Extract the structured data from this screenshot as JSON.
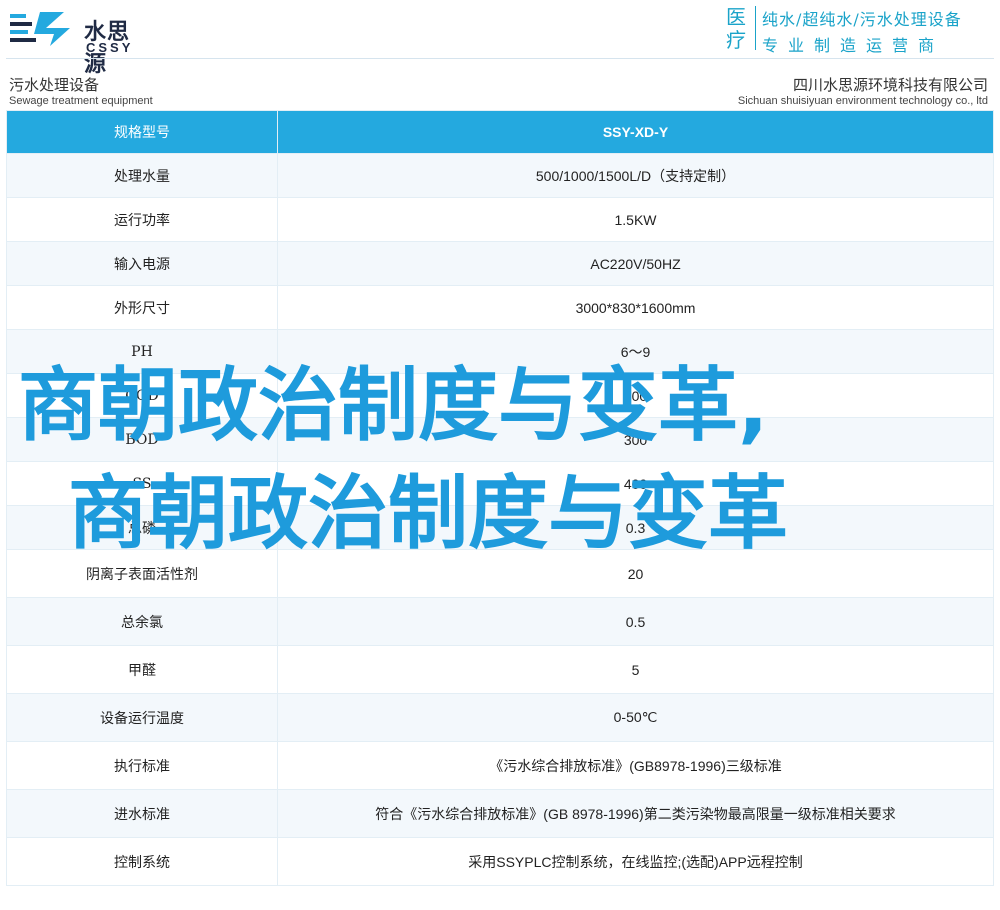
{
  "brand": {
    "name_cn": "水思源",
    "name_en": "CSSY"
  },
  "tagline": {
    "side": [
      "医",
      "疗"
    ],
    "line1": "纯水/超纯水/污水处理设备",
    "line2": "专业制造运营商"
  },
  "subheader": {
    "title_cn": "污水处理设备",
    "title_en": "Sewage treatment equipment",
    "company_cn": "四川水思源环境科技有限公司",
    "company_en": "Sichuan shuisiyuan environment technology co., ltd"
  },
  "spec_table": {
    "header": {
      "label": "规格型号",
      "value": "SSY-XD-Y"
    },
    "rows": [
      {
        "label": "处理水量",
        "value": "500/1000/1500L/D（支持定制）"
      },
      {
        "label": "运行功率",
        "value": "1.5KW"
      },
      {
        "label": "输入电源",
        "value": "AC220V/50HZ"
      },
      {
        "label": "外形尺寸",
        "value": "3000*830*1600mm"
      },
      {
        "label": "PH",
        "value": "6～9"
      },
      {
        "label": "COD",
        "value": "500"
      },
      {
        "label": "BOD",
        "value": "300"
      },
      {
        "label": "SS",
        "value": "400"
      },
      {
        "label": "总磷",
        "value": "0.3"
      },
      {
        "label": "阴离子表面活性剂",
        "value": "20"
      },
      {
        "label": "总余氯",
        "value": "0.5"
      },
      {
        "label": "甲醛",
        "value": "5"
      },
      {
        "label": "设备运行温度",
        "value": "0-50℃"
      },
      {
        "label": "执行标准",
        "value": "《污水综合排放标准》(GB8978-1996)三级标准"
      },
      {
        "label": "进水标准",
        "value": "符合《污水综合排放标准》(GB 8978-1996)第二类污染物最高限量一级标准相关要求"
      },
      {
        "label": "控制系统",
        "value": "采用SSYPLC控制系统，在线监控;(选配)APP远程控制"
      }
    ]
  },
  "watermark": {
    "line1": "商朝政治制度与变革,",
    "line2": "商朝政治制度与变革"
  },
  "colors": {
    "accent": "#24a9df",
    "brand_dark": "#1f2a44",
    "tagline": "#1aa3c9",
    "row_alt": "#f3f8fc",
    "watermark": "#1e9bdc"
  }
}
